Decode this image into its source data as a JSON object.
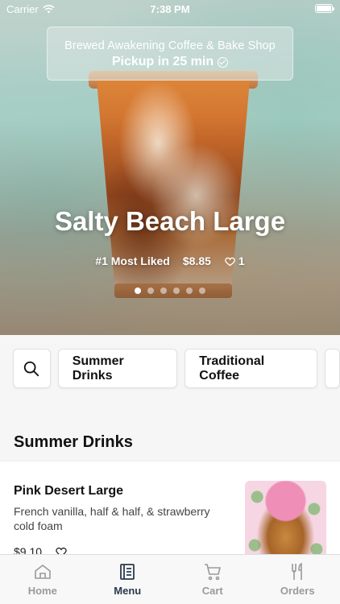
{
  "status_bar": {
    "carrier": "Carrier",
    "time": "7:38 PM"
  },
  "hero": {
    "shop_name": "Brewed Awakening Coffee & Bake Shop",
    "pickup": "Pickup in 25 min",
    "drink_name": "Salty Beach Large",
    "rank": "#1 Most Liked",
    "price": "$8.85",
    "likes": "1",
    "carousel_pages": 6,
    "carousel_active_index": 0
  },
  "filters": {
    "search_icon": "search-icon",
    "chips": [
      "Summer Drinks",
      "Traditional Coffee"
    ]
  },
  "section": {
    "title": "Summer Drinks"
  },
  "items": [
    {
      "name": "Pink Desert Large",
      "description": "French vanilla, half & half, & strawberry cold foam",
      "price": "$9.10",
      "icon": "heart-icon"
    }
  ],
  "tabs": [
    {
      "label": "Home",
      "icon": "home-icon"
    },
    {
      "label": "Menu",
      "icon": "menu-icon",
      "active": true
    },
    {
      "label": "Cart",
      "icon": "cart-icon"
    },
    {
      "label": "Orders",
      "icon": "utensils-icon"
    }
  ],
  "colors": {
    "active_tab": "#2b3a4f",
    "inactive_tab": "#9a9a9a"
  }
}
